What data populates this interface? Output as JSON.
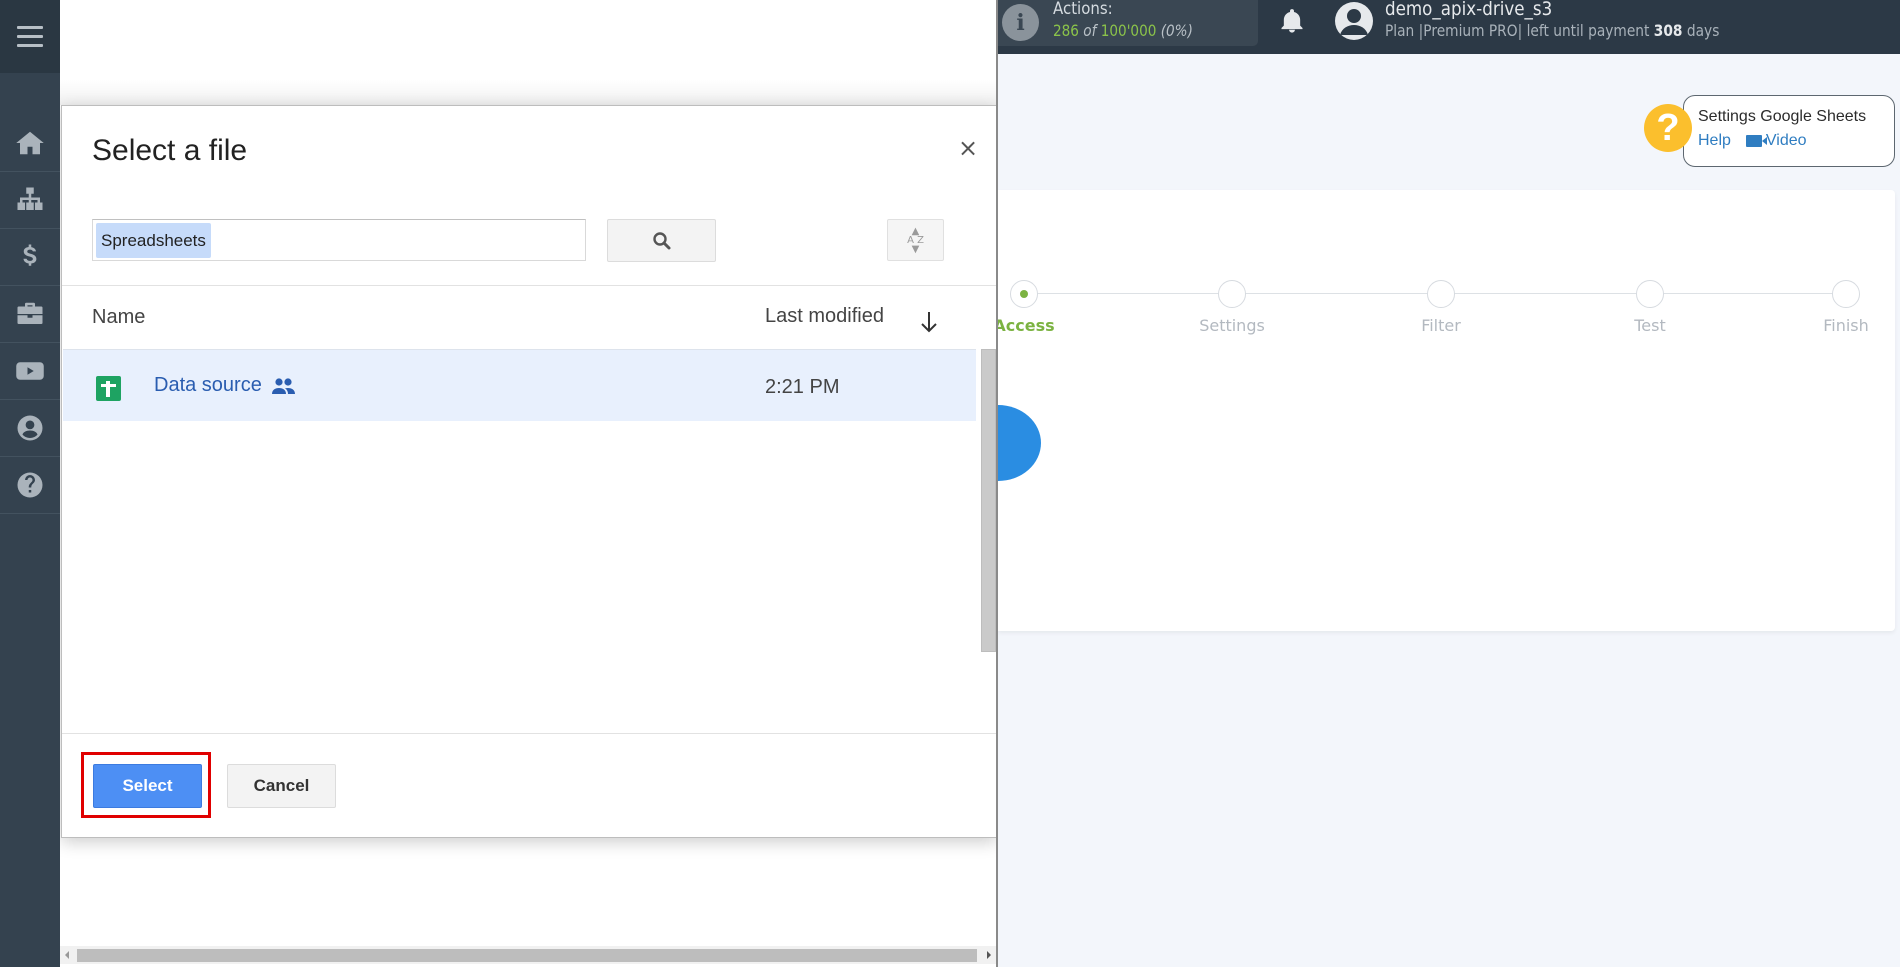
{
  "sidebar": {
    "items": [
      {
        "id": "home",
        "icon": "home-icon"
      },
      {
        "id": "connections",
        "icon": "sitemap-icon"
      },
      {
        "id": "billing",
        "icon": "dollar-icon"
      },
      {
        "id": "services",
        "icon": "briefcase-icon"
      },
      {
        "id": "videos",
        "icon": "youtube-icon"
      },
      {
        "id": "account",
        "icon": "user-circle-icon"
      },
      {
        "id": "help",
        "icon": "question-circle-icon"
      }
    ]
  },
  "header": {
    "actions_label": "Actions:",
    "actions_used": "286",
    "actions_of": "of",
    "actions_total": "100'000",
    "actions_percent": "(0%)",
    "username": "demo_apix-drive_s3",
    "plan_prefix": "Plan |Premium PRO| left until payment",
    "days_left": "308",
    "days_suffix": "days"
  },
  "help": {
    "title": "Settings Google Sheets",
    "help_link": "Help",
    "video_link": "Video"
  },
  "steps": {
    "current": 0,
    "items": [
      "Access",
      "Settings",
      "Filter",
      "Test",
      "Finish"
    ]
  },
  "dialog": {
    "title": "Select a file",
    "close_label": "×",
    "search_value": "Spreadsheets",
    "sort_label": "A Z",
    "columns": {
      "name": "Name",
      "modified": "Last modified"
    },
    "files": [
      {
        "name": "Data source",
        "shared": true,
        "modified": "2:21 PM",
        "selected": true
      }
    ],
    "select_label": "Select",
    "cancel_label": "Cancel"
  },
  "colors": {
    "accent_green": "#7cb342",
    "select_blue": "#4d8ff4",
    "highlight_red": "#e00000",
    "help_yellow": "#fbbf2d",
    "sidebar_bg": "#34424f"
  }
}
